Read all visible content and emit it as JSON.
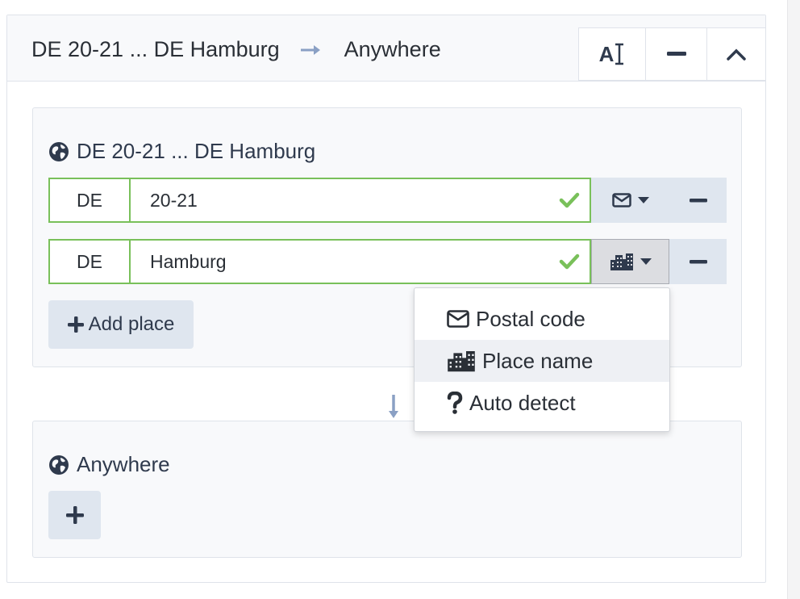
{
  "header": {
    "origin_summary": "DE 20-21 ... DE Hamburg",
    "destination_summary": "Anywhere",
    "buttons": [
      {
        "name": "text-format-button",
        "label": "A"
      },
      {
        "name": "minimize-button"
      },
      {
        "name": "collapse-button"
      }
    ]
  },
  "origin": {
    "title": "DE 20-21 ... DE Hamburg",
    "places": [
      {
        "country": "DE",
        "value": "20-21",
        "type_icon": "envelope-icon",
        "valid": true
      },
      {
        "country": "DE",
        "value": "Hamburg",
        "type_icon": "building-icon",
        "valid": true
      }
    ],
    "add_place_label": "Add place"
  },
  "destination": {
    "title": "Anywhere"
  },
  "type_dropdown": {
    "items": [
      {
        "icon": "envelope-icon",
        "label": "Postal code"
      },
      {
        "icon": "building-icon",
        "label": "Place name",
        "active": true
      },
      {
        "icon": "question-icon",
        "label": "Auto detect"
      }
    ]
  },
  "colors": {
    "valid_green": "#79c05a",
    "text_dark": "#2f3a4d",
    "button_bg": "#dfe6ef",
    "arrow_blue": "#8aa0c4"
  }
}
